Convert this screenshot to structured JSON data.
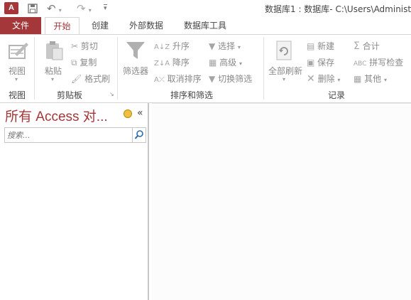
{
  "app": {
    "icon_text": "A",
    "window_title": "数据库1 : 数据库- C:\\Users\\Administ"
  },
  "qat": {
    "undo_arrow": "▾",
    "redo_arrow": "▾",
    "customize": "▾"
  },
  "tabs": [
    "文件",
    "开始",
    "创建",
    "外部数据",
    "数据库工具"
  ],
  "ribbon": {
    "view": {
      "button_label": "视图",
      "group_label": "视图"
    },
    "clipboard": {
      "paste_label": "粘贴",
      "cut_label": "剪切",
      "copy_label": "复制",
      "format_painter_label": "格式刷",
      "group_label": "剪贴板"
    },
    "sort_filter": {
      "filter_label": "筛选器",
      "ascending_label": "升序",
      "descending_label": "降序",
      "clear_sort_label": "取消排序",
      "selection_label": "选择",
      "advanced_label": "高级",
      "toggle_filter_label": "切换筛选",
      "group_label": "排序和筛选"
    },
    "records": {
      "refresh_label": "全部刷新",
      "new_label": "新建",
      "save_label": "保存",
      "delete_label": "删除",
      "totals_label": "合计",
      "spelling_label": "拼写检查",
      "more_label": "其他",
      "group_label": "记录"
    }
  },
  "nav_pane": {
    "title": "所有 Access 对...",
    "collapse_glyph": "«",
    "search_placeholder": "搜索..."
  },
  "colors": {
    "accent": "#a4373a",
    "disabled": "#a5a5a5"
  }
}
